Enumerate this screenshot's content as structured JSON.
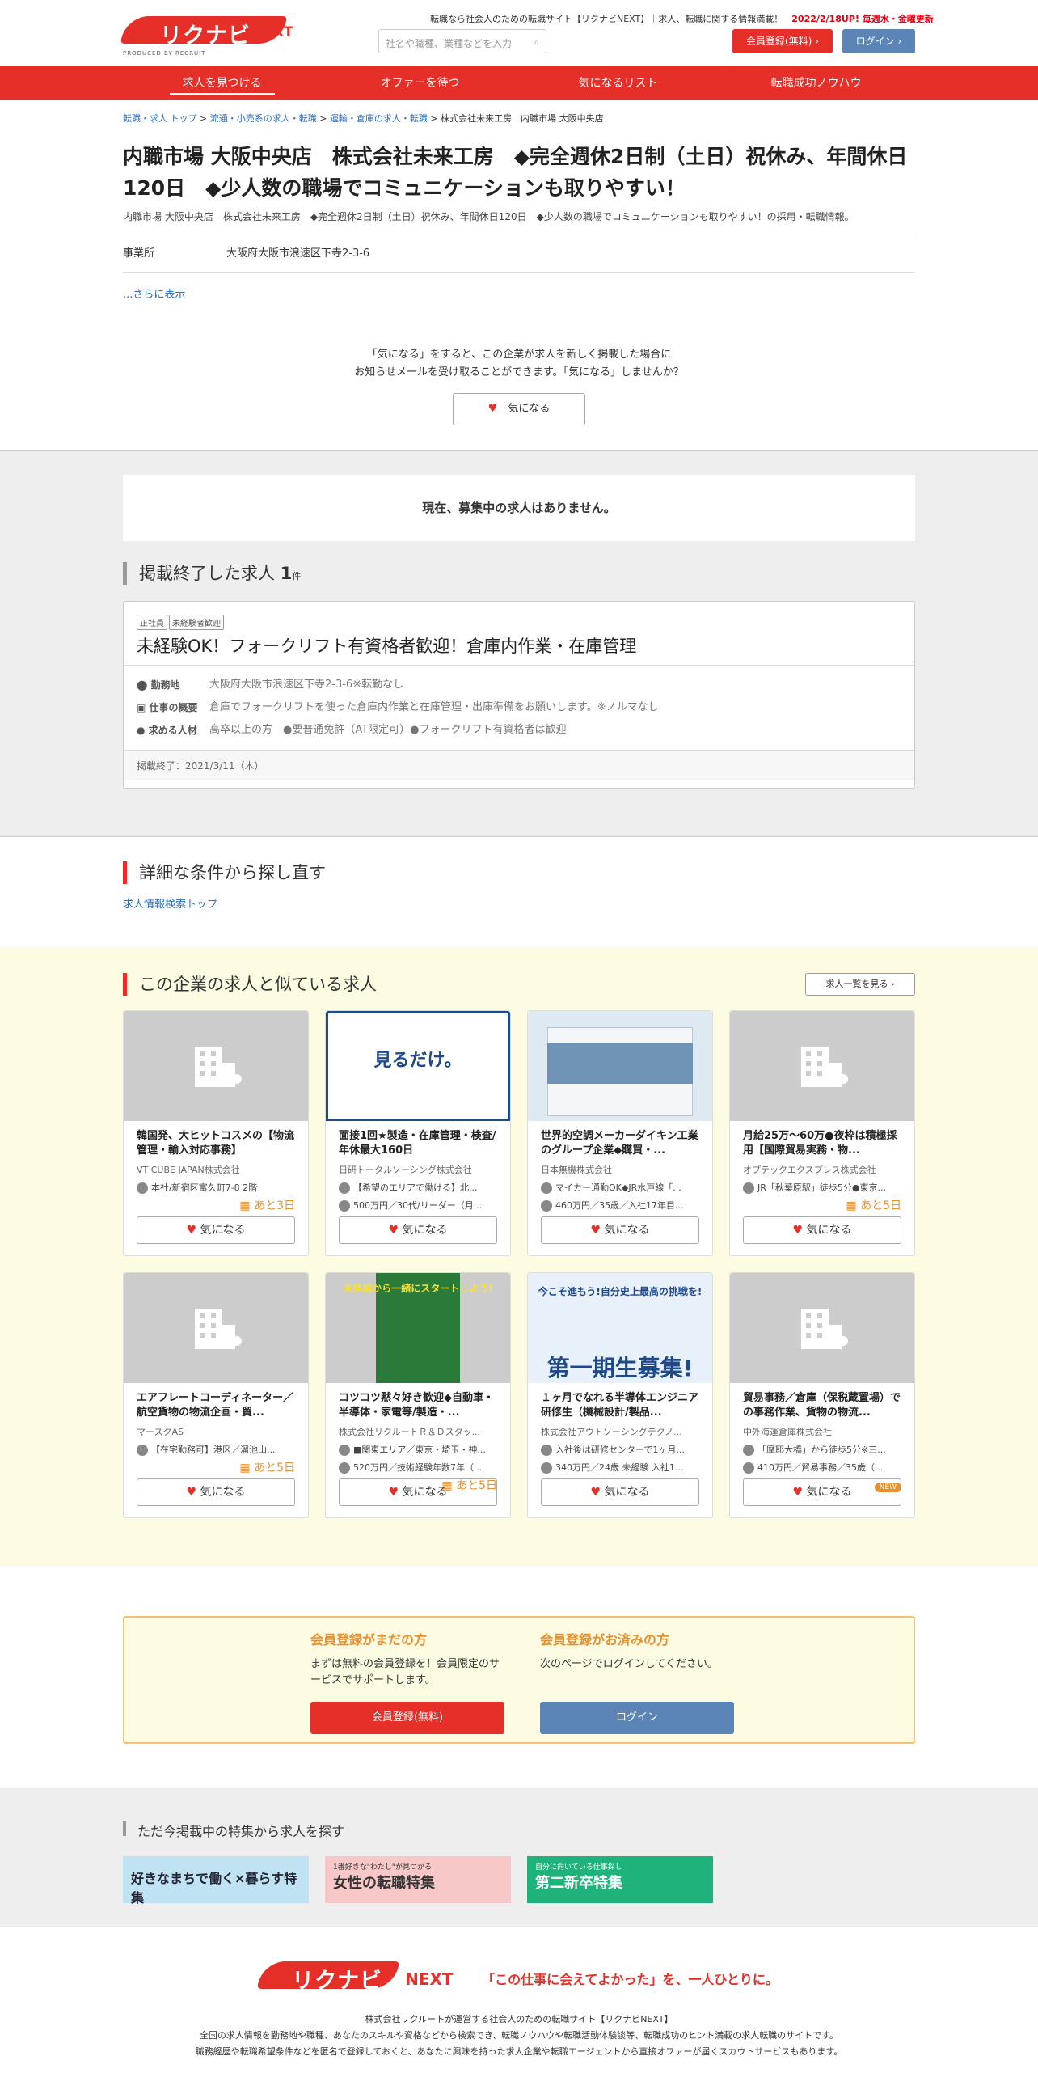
{
  "header": {
    "logo_text": "リクナビ",
    "logo_next": "NEXT",
    "logo_sub": "PRODUCED BY RECRUIT",
    "tagline": "転職なら社会人のための転職サイト【リクナビNEXT】｜求人、転職に関する情報満載！",
    "tagline_red": "2022/2/18UP! 毎週水・金曜更新",
    "search_placeholder": "社名や職種、業種などを入力",
    "register": "会員登録(無料)",
    "login": "ログイン"
  },
  "nav": [
    "求人を見つける",
    "オファーを待つ",
    "気になるリスト",
    "転職成功ノウハウ"
  ],
  "breadcrumb": {
    "c1": "転職・求人 トップ",
    "c2": "流通・小売系の求人・転職",
    "c3": "運輸・倉庫の求人・転職",
    "c4": "株式会社未来工房　内職市場 大阪中央店"
  },
  "company": {
    "title": "内職市場 大阪中央店　株式会社未来工房　◆完全週休2日制（土日）祝休み、年間休日120日　◆少人数の職場でコミュニケーションも取りやすい！",
    "subtitle": "内職市場 大阪中央店　株式会社未来工房　◆完全週休2日制（土日）祝休み、年間休日120日　◆少人数の職場でコミュニケーションも取りやすい！の採用・転職情報。",
    "office_label": "事業所",
    "office_value": "大阪府大阪市浪速区下寺2-3-6",
    "more": "...さらに表示"
  },
  "kininaru": {
    "line1": "「気になる」をすると、この企業が求人を新しく掲載した場合に",
    "line2": "お知らせメールを受け取ることができます。「気になる」しませんか？",
    "button": "気になる"
  },
  "no_jobs": "現在、募集中の求人はありません。",
  "ended": {
    "title": "掲載終了した求人",
    "count": "1",
    "unit": "件",
    "tag1": "正社員",
    "tag2": "未経験者歓迎",
    "job_title": "未経験OK！フォークリフト有資格者歓迎！倉庫内作業・在庫管理",
    "loc_label": "勤務地",
    "loc": "大阪府大阪市浪速区下寺2-3-6※転勤なし",
    "work_label": "仕事の概要",
    "work": "倉庫でフォークリフトを使った倉庫内作業と在庫管理・出庫準備をお願いします。※ノルマなし",
    "req_label": "求める人材",
    "req": "高卒以上の方　●要普通免許（AT限定可）●フォークリフト有資格者は歓迎",
    "end_date": "掲載終了：2021/3/11（木）"
  },
  "detail": {
    "title": "詳細な条件から探し直す",
    "link": "求人情報検索トップ"
  },
  "similar": {
    "title": "この企業の求人と似ている求人",
    "list_button": "求人一覧を見る",
    "jobs": [
      {
        "title": "韓国発、大ヒットコスメの【物流管理・輸入対応事務】",
        "company": "VT CUBE JAPAN株式会社",
        "r1": "本社/新宿区富久町7-8 2階",
        "r2": "",
        "days": "あと3日",
        "btn": "気になる"
      },
      {
        "title": "面接1回★製造・在庫管理・検査/年休最大160日",
        "company": "日研トータルソーシング株式会社",
        "r1": "【希望のエリアで働ける】北...",
        "r2": "500万円／30代/リーダー（月...",
        "days": "",
        "btn": "気になる",
        "img_text": "見るだけ。"
      },
      {
        "title": "世界的空調メーカーダイキン工業のグループ企業◆購買・...",
        "company": "日本無機株式会社",
        "r1": "マイカー通勤OK◆JR水戸線「...",
        "r2": "460万円／35歳／入社17年目...",
        "days": "",
        "btn": "気になる"
      },
      {
        "title": "月給25万～60万●夜枠は積極採用【国際貿易実務・物...",
        "company": "オプテックエクスプレス株式会社",
        "r1": "JR「秋葉原駅」徒歩5分●東京...",
        "r2": "",
        "days": "あと5日",
        "btn": "気になる"
      },
      {
        "title": "エアフレートコーディネーター／航空貨物の物流企画・貿...",
        "company": "マースクAS",
        "r1": "【在宅勤務可】港区／溜池山...",
        "r2": "",
        "days": "あと5日",
        "btn": "気になる"
      },
      {
        "title": "コツコツ黙々好き歓迎◆自動車・半導体・家電等/製造・...",
        "company": "株式会社リクルートＲ＆Ｄスタッ...",
        "r1": "■関東エリア／東京・埼玉・神...",
        "r2": "520万円／技術経験年数7年（...",
        "days": "あと5日",
        "btn": "気になる",
        "img_text": "未経験から一緒にスタートしよう!"
      },
      {
        "title": "１ヶ月でなれる半導体エンジニア研修生（機械設計/製品...",
        "company": "株式会社アウトソーシングテクノ...",
        "r1": "入社後は研修センターで1ヶ月...",
        "r2": "340万円／24歳 未経験 入社1...",
        "days": "",
        "btn": "気になる",
        "img_text": "今こそ進もう!自分史上最高の挑戦を!",
        "img_big": "第一期生募集!"
      },
      {
        "title": "貿易事務／倉庫（保税蔵置場）での事務作業、貨物の物流...",
        "company": "中外海運倉庫株式会社",
        "r1": "「摩耶大橋」から徒歩5分※三...",
        "r2": "410万円／貿易事務／35歳（...",
        "days": "",
        "badge": "NEW",
        "btn": "気になる"
      }
    ]
  },
  "member": {
    "h1": "会員登録がまだの方",
    "p1": "まずは無料の会員登録を！会員限定のサービスでサポートします。",
    "b1": "会員登録(無料)",
    "h2": "会員登録がお済みの方",
    "p2": "次のページでログインしてください。",
    "b2": "ログイン"
  },
  "features": {
    "title": "ただ今掲載中の特集から求人を探す",
    "b1": "好きなまちで働く×暮らす特集",
    "b2_small": "1番好きな\"わたし\"が見つかる",
    "b2": "女性の転職特集",
    "b3_small": "自分に向いている仕事探し",
    "b3": "第二新卒特集"
  },
  "footer": {
    "catch": "「この仕事に会えてよかった」を、一人ひとりに。",
    "l1": "株式会社リクルートが運営する社会人のための転職サイト【リクナビNEXT】",
    "l2": "全国の求人情報を勤務地や職種、あなたのスキルや資格などから検索でき、転職ノウハウや転職活動体験談等、転職成功のヒント満載の求人転職のサイトです。",
    "l3": "職務経歴や転職希望条件などを匿名で登録しておくと、あなたに興味を持った求人企業や転職エージェントから直接オファーが届くスカウトサービスもあります。"
  }
}
